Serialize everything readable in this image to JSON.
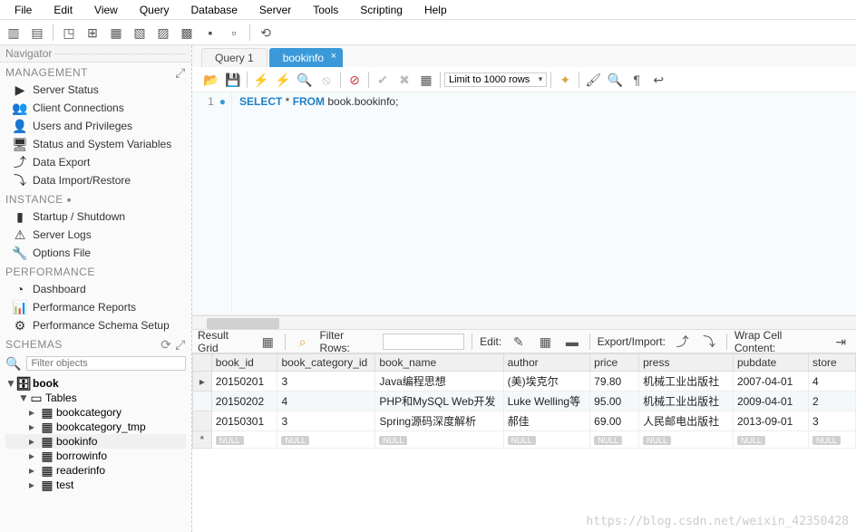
{
  "menu": [
    "File",
    "Edit",
    "View",
    "Query",
    "Database",
    "Server",
    "Tools",
    "Scripting",
    "Help"
  ],
  "nav": {
    "title": "Navigator",
    "management": {
      "title": "MANAGEMENT",
      "items": [
        "Server Status",
        "Client Connections",
        "Users and Privileges",
        "Status and System Variables",
        "Data Export",
        "Data Import/Restore"
      ]
    },
    "instance": {
      "title": "INSTANCE",
      "items": [
        "Startup / Shutdown",
        "Server Logs",
        "Options File"
      ]
    },
    "performance": {
      "title": "PERFORMANCE",
      "items": [
        "Dashboard",
        "Performance Reports",
        "Performance Schema Setup"
      ]
    },
    "schemas": {
      "title": "SCHEMAS",
      "filter_placeholder": "Filter objects",
      "db": "book",
      "tables_label": "Tables",
      "tables": [
        "bookcategory",
        "bookcategory_tmp",
        "bookinfo",
        "borrowinfo",
        "readerinfo",
        "test"
      ]
    }
  },
  "tabs": {
    "inactive": "Query 1",
    "active": "bookinfo"
  },
  "toolbar": {
    "limit_label": "Limit to 1000 rows"
  },
  "editor": {
    "line_no": "1",
    "kw1": "SELECT",
    "star": " * ",
    "kw2": "FROM",
    "rest": " book.bookinfo;"
  },
  "result": {
    "grid_label": "Result Grid",
    "filter_label": "Filter Rows:",
    "edit_label": "Edit:",
    "exp_label": "Export/Import:",
    "wrap_label": "Wrap Cell Content:",
    "columns": [
      "book_id",
      "book_category_id",
      "book_name",
      "author",
      "price",
      "press",
      "pubdate",
      "store"
    ],
    "rows": [
      [
        "20150201",
        "3",
        "Java编程思想",
        "(美)埃克尔",
        "79.80",
        "机械工业出版社",
        "2007-04-01",
        "4"
      ],
      [
        "20150202",
        "4",
        "PHP和MySQL Web开发",
        "Luke Welling等",
        "95.00",
        "机械工业出版社",
        "2009-04-01",
        "2"
      ],
      [
        "20150301",
        "3",
        "Spring源码深度解析",
        "郝佳",
        "69.00",
        "人民邮电出版社",
        "2013-09-01",
        "3"
      ]
    ],
    "null_label": "NULL"
  },
  "watermark": "https://blog.csdn.net/weixin_42350428"
}
